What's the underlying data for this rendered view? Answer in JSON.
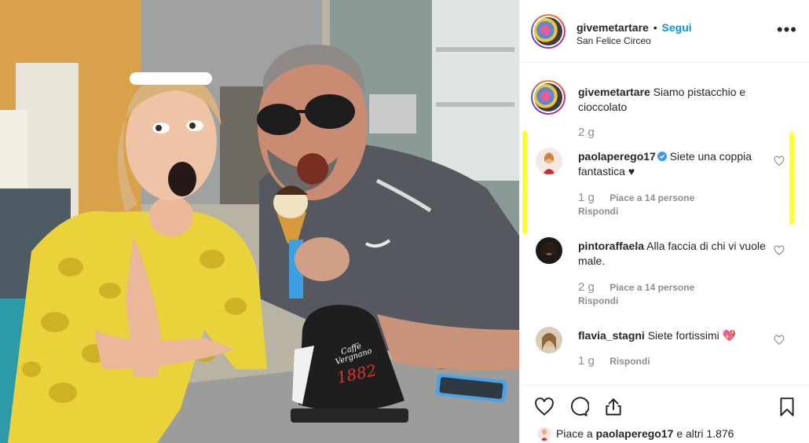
{
  "post": {
    "username": "givemetartare",
    "dot": "•",
    "follow_label": "Segui",
    "location": "San Felice Circeo",
    "more_label": "•••"
  },
  "photo": {
    "cup_brand": "Caffè Vergnano",
    "cup_year": "1882"
  },
  "caption": {
    "username": "givemetartare",
    "text": "Siamo pistacchio e cioccolato",
    "age": "2 g"
  },
  "comments": [
    {
      "username": "paolaperego17",
      "verified": true,
      "text": "Siete una coppia fantastica ♥",
      "age": "1 g",
      "likes": "Piace a 14 persone",
      "reply": "Rispondi"
    },
    {
      "username": "pintoraffaela",
      "verified": false,
      "text": "Alla faccia di chi vi vuole male.",
      "age": "2 g",
      "likes": "Piace a 14 persone",
      "reply": "Rispondi"
    },
    {
      "username": "flavia_stagni",
      "verified": false,
      "text": "Siete fortissimi 💖",
      "age": "1 g",
      "reply": "Rispondi"
    }
  ],
  "actions": {
    "like_icon": "heart-outline-icon",
    "comment_icon": "comment-bubble-icon",
    "share_icon": "share-icon",
    "save_icon": "bookmark-icon"
  },
  "likes_summary": {
    "prefix": "Piace a",
    "user": "paolaperego17",
    "suffix": "e altri 1.876"
  },
  "colors": {
    "accent": "#0095f6",
    "highlight": "#ffff2e",
    "text": "#262626",
    "muted": "#8e8e8e"
  }
}
